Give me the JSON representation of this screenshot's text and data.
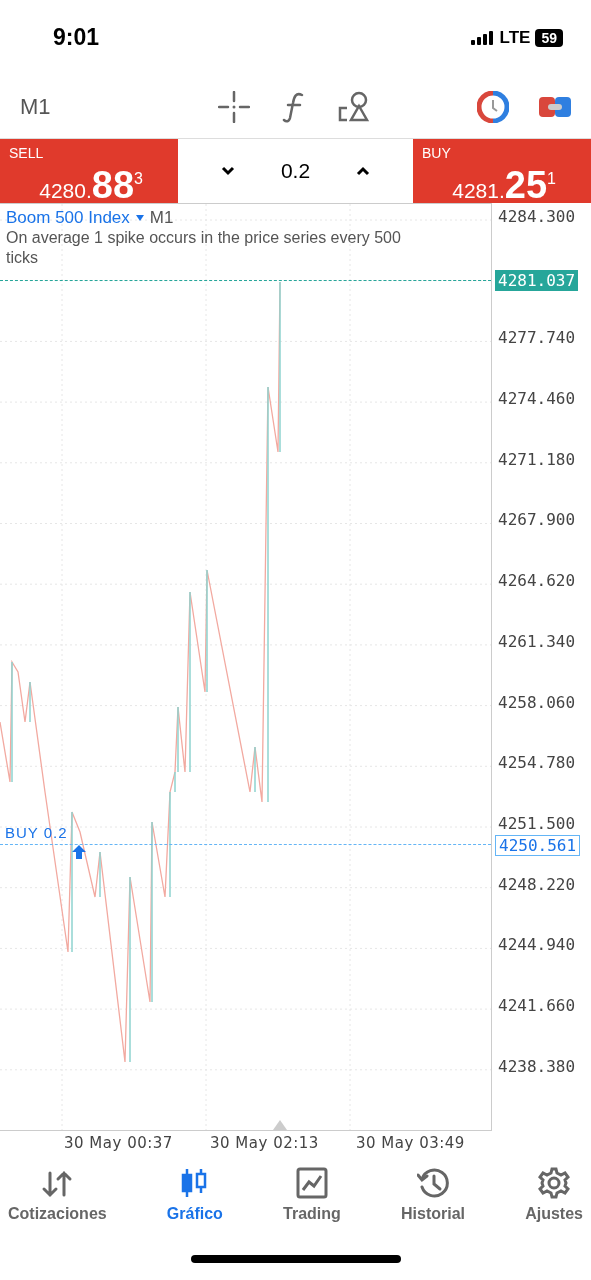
{
  "status_bar": {
    "time": "9:01",
    "network": "LTE",
    "battery": "59"
  },
  "toolbar": {
    "timeframe": "M1"
  },
  "trade_panel": {
    "sell": {
      "label": "SELL",
      "price": "4280.**88**$^{3}$"
    },
    "volume": "0.2",
    "buy": {
      "label": "BUY",
      "price": "4281.**25**$^{1}$"
    }
  },
  "chart": {
    "symbol": "Boom 500 Index",
    "timeframe": "M1",
    "description": "On average 1 spike occurs in the price series every 500 ticks",
    "price_labels": [
      "4284.300",
      "4277.740",
      "4274.460",
      "4271.180",
      "4267.900",
      "4264.620",
      "4261.340",
      "4258.060",
      "4254.780",
      "4251.500",
      "4248.220",
      "4244.940",
      "4241.660",
      "4238.380"
    ],
    "current_price": "4281.037",
    "order_line": {
      "label": "BUY 0.2",
      "price": "4250.561"
    },
    "time_labels": [
      "30 May 00:37",
      "30 May 02:13",
      "30 May 03:49"
    ]
  },
  "nav": [
    {
      "label": "Cotizaciones",
      "selected": false
    },
    {
      "label": "Gráfico",
      "selected": true
    },
    {
      "label": "Trading",
      "selected": false
    },
    {
      "label": "Historial",
      "selected": false
    },
    {
      "label": "Ajustes",
      "selected": false
    }
  ]
}
